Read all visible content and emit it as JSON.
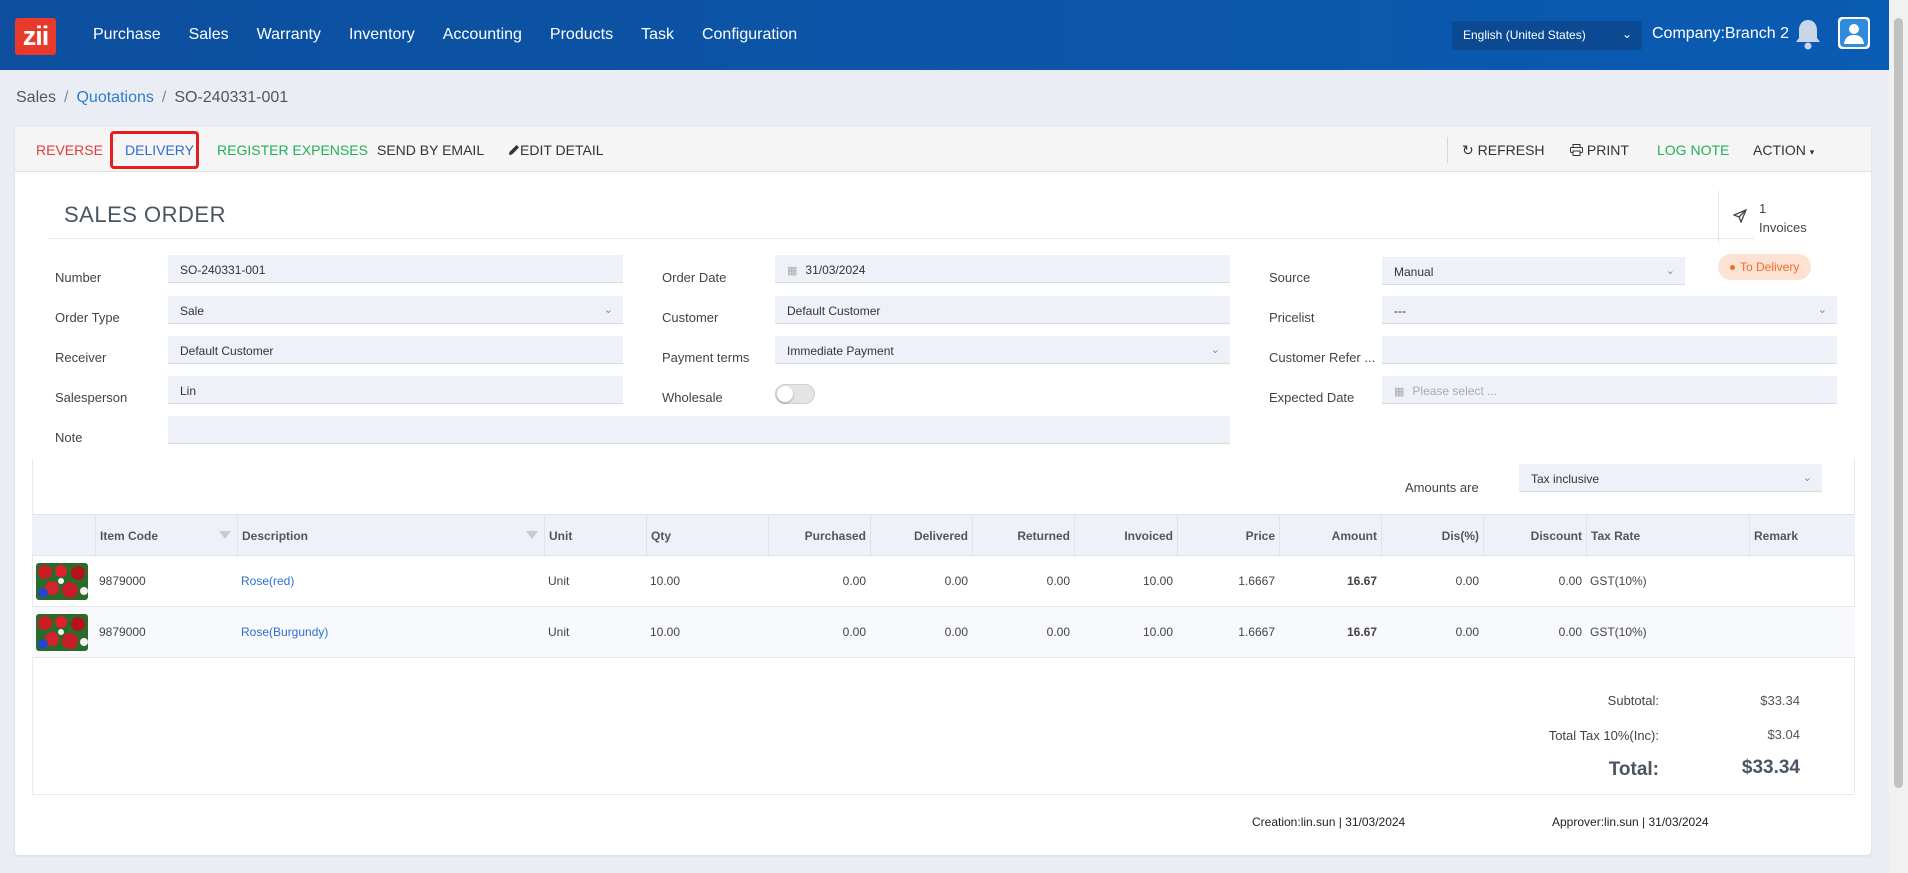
{
  "nav": {
    "logo": "zii",
    "items": [
      "Purchase",
      "Sales",
      "Warranty",
      "Inventory",
      "Accounting",
      "Products",
      "Task",
      "Configuration"
    ],
    "language": "English (United States)",
    "company": "Company:Branch 2"
  },
  "breadcrumb": {
    "root": "Sales",
    "section": "Quotations",
    "current": "SO-240331-001"
  },
  "toolbar": {
    "reverse": "REVERSE",
    "delivery": "DELIVERY",
    "register_expenses": "REGISTER EXPENSES",
    "send_email": "SEND BY EMAIL",
    "edit_detail": "EDIT DETAIL",
    "refresh": "REFRESH",
    "print": "PRINT",
    "log_note": "LOG NOTE",
    "action": "ACTION"
  },
  "form": {
    "title": "SALES ORDER",
    "invoices_count": "1",
    "invoices_label": "Invoices",
    "status": "To Delivery",
    "number_label": "Number",
    "number": "SO-240331-001",
    "order_type_label": "Order Type",
    "order_type": "Sale",
    "receiver_label": "Receiver",
    "receiver": "Default Customer",
    "salesperson_label": "Salesperson",
    "salesperson": "Lin",
    "note_label": "Note",
    "note": "",
    "order_date_label": "Order Date",
    "order_date": "31/03/2024",
    "customer_label": "Customer",
    "customer": "Default Customer",
    "payment_terms_label": "Payment terms",
    "payment_terms": "Immediate Payment",
    "wholesale_label": "Wholesale",
    "source_label": "Source",
    "source": "Manual",
    "pricelist_label": "Pricelist",
    "pricelist": "---",
    "customer_ref_label": "Customer Refer ...",
    "customer_ref": "",
    "expected_date_label": "Expected Date",
    "expected_date_placeholder": "Please select ..."
  },
  "amounts": {
    "label": "Amounts are",
    "value": "Tax inclusive"
  },
  "table": {
    "headers": [
      "Item Code",
      "Description",
      "Unit",
      "Qty",
      "Purchased",
      "Delivered",
      "Returned",
      "Invoiced",
      "Price",
      "Amount",
      "Dis(%)",
      "Discount",
      "Tax Rate",
      "Remark"
    ],
    "rows": [
      [
        "9879000",
        "Rose(red)",
        "Unit",
        "10.00",
        "0.00",
        "0.00",
        "0.00",
        "10.00",
        "1.6667",
        "16.67",
        "0.00",
        "0.00",
        "GST(10%)",
        ""
      ],
      [
        "9879000",
        "Rose(Burgundy)",
        "Unit",
        "10.00",
        "0.00",
        "0.00",
        "0.00",
        "10.00",
        "1.6667",
        "16.67",
        "0.00",
        "0.00",
        "GST(10%)",
        ""
      ]
    ]
  },
  "totals": {
    "subtotal_label": "Subtotal:",
    "subtotal": "$33.34",
    "tax_label": "Total Tax 10%(Inc):",
    "tax": "$3.04",
    "total_label": "Total:",
    "total": "$33.34"
  },
  "footer": {
    "creation": "Creation:lin.sun | 31/03/2024",
    "approver": "Approver:lin.sun | 31/03/2024"
  },
  "colors": {
    "nav_bg": "#0b56aa",
    "accent_red": "#e23b3b",
    "accent_green": "#22b05a",
    "link_blue": "#2e6fd0",
    "status_orange": "#ef6c2e"
  }
}
